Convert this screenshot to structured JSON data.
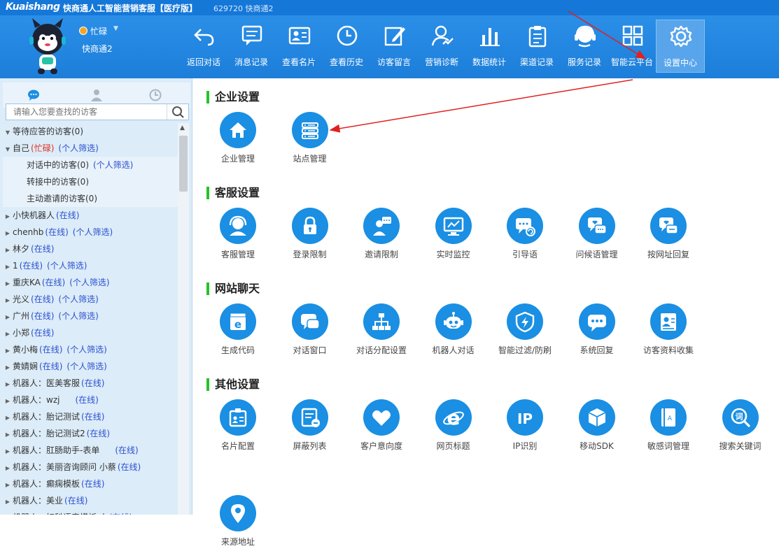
{
  "titlebar": {
    "logo": "Kuaishang",
    "title": "快商通人工智能营销客服【医疗版】",
    "account": "629720 快商通2"
  },
  "user": {
    "status": "忙碌",
    "name": "快商通2"
  },
  "colors": {
    "accent": "#1a8fe3",
    "titlebar": "#1577d8",
    "section_bar": "#27c229",
    "online": "#2a4fd0",
    "busy": "#e0301e"
  },
  "toolbar": [
    {
      "label": "返回对话",
      "icon": "return-icon"
    },
    {
      "label": "消息记录",
      "icon": "message-icon"
    },
    {
      "label": "查看名片",
      "icon": "card-icon"
    },
    {
      "label": "查看历史",
      "icon": "clock-icon"
    },
    {
      "label": "访客留言",
      "icon": "edit-icon"
    },
    {
      "label": "营销诊断",
      "icon": "diagnosis-icon"
    },
    {
      "label": "数据统计",
      "icon": "bar-chart-icon"
    },
    {
      "label": "渠道记录",
      "icon": "clipboard-icon"
    },
    {
      "label": "服务记录",
      "icon": "headset-icon"
    },
    {
      "label": "智能云平台",
      "icon": "grid-icon"
    },
    {
      "label": "设置中心",
      "icon": "gear-icon",
      "active": true
    }
  ],
  "sidebar": {
    "search_placeholder": "请输入您要查找的访客",
    "rows": [
      {
        "text": "等待应答的访客(0)",
        "expanded": true
      },
      {
        "text": "自己",
        "status": "(忙碌)",
        "status_type": "busy",
        "extra": "(个人筛选)",
        "expanded": true
      },
      {
        "text": "对话中的访客(0)",
        "extra": "(个人筛选)",
        "sub": true
      },
      {
        "text": "转接中的访客(0)",
        "sub": true
      },
      {
        "text": "主动邀请的访客(0)",
        "sub": true
      },
      {
        "text": "小快机器人",
        "status": "(在线)"
      },
      {
        "text": "chenhb",
        "status": "(在线)",
        "extra": "(个人筛选)"
      },
      {
        "text": "林夕",
        "status": "(在线)"
      },
      {
        "text": "1",
        "status": "(在线)",
        "extra": "(个人筛选)"
      },
      {
        "text": "重庆KA",
        "status": "(在线)",
        "extra": "(个人筛选)"
      },
      {
        "text": "光义",
        "status": "(在线)",
        "extra": "(个人筛选)"
      },
      {
        "text": "广州",
        "status": "(在线)",
        "extra": "(个人筛选)"
      },
      {
        "text": "小郑",
        "status": "(在线)"
      },
      {
        "text": "黄小梅",
        "status": "(在线)",
        "extra": "(个人筛选)"
      },
      {
        "text": "黄婧娴",
        "status": "(在线)",
        "extra": "(个人筛选)"
      },
      {
        "text": "机器人：医美客服",
        "status": "(在线)"
      },
      {
        "text": "机器人：wzj",
        "status": "(在线)",
        "gap": true
      },
      {
        "text": "机器人：胎记测试",
        "status": "(在线)"
      },
      {
        "text": "机器人：胎记测试2",
        "status": "(在线)"
      },
      {
        "text": "机器人：肛肠助手-表单",
        "status": "(在线)",
        "gap": true
      },
      {
        "text": "机器人：美丽咨询顾问 小蔡",
        "status": "(在线)"
      },
      {
        "text": "机器人：癫痫模板",
        "status": "(在线)"
      },
      {
        "text": "机器人：美业",
        "status": "(在线)"
      },
      {
        "text": "机器人：妇科语音模板 小",
        "status": "(在线)"
      }
    ]
  },
  "sections": [
    {
      "title": "企业设置",
      "items": [
        {
          "label": "企业管理",
          "icon": "home-icon"
        },
        {
          "label": "站点管理",
          "icon": "server-icon"
        }
      ]
    },
    {
      "title": "客服设置",
      "items": [
        {
          "label": "客服管理",
          "icon": "agent-icon"
        },
        {
          "label": "登录限制",
          "icon": "lock-icon"
        },
        {
          "label": "邀请限制",
          "icon": "invite-icon"
        },
        {
          "label": "实时监控",
          "icon": "monitor-icon"
        },
        {
          "label": "引导语",
          "icon": "guide-chat-icon"
        },
        {
          "label": "问候语管理",
          "icon": "greeting-icon"
        },
        {
          "label": "按网址回复",
          "icon": "url-reply-icon"
        }
      ]
    },
    {
      "title": "网站聊天",
      "items": [
        {
          "label": "生成代码",
          "icon": "code-browser-icon"
        },
        {
          "label": "对话窗口",
          "icon": "chat-window-icon"
        },
        {
          "label": "对话分配设置",
          "icon": "hierarchy-icon"
        },
        {
          "label": "机器人对话",
          "icon": "robot-icon"
        },
        {
          "label": "智能过滤/防刷",
          "icon": "shield-icon"
        },
        {
          "label": "系统回复",
          "icon": "system-reply-icon"
        },
        {
          "label": "访客资料收集",
          "icon": "profile-icon"
        }
      ]
    },
    {
      "title": "其他设置",
      "items": [
        {
          "label": "名片配置",
          "icon": "badge-icon"
        },
        {
          "label": "屏蔽列表",
          "icon": "block-list-icon"
        },
        {
          "label": "客户意向度",
          "icon": "heart-icon"
        },
        {
          "label": "网页标题",
          "icon": "ie-icon"
        },
        {
          "label": "IP识别",
          "icon": "ip-icon"
        },
        {
          "label": "移动SDK",
          "icon": "cube-icon"
        },
        {
          "label": "敏感词管理",
          "icon": "sensitive-book-icon"
        },
        {
          "label": "搜索关键词",
          "icon": "keyword-search-icon"
        }
      ]
    },
    {
      "title": "",
      "items": [
        {
          "label": "来源地址",
          "icon": "location-icon"
        }
      ]
    }
  ]
}
